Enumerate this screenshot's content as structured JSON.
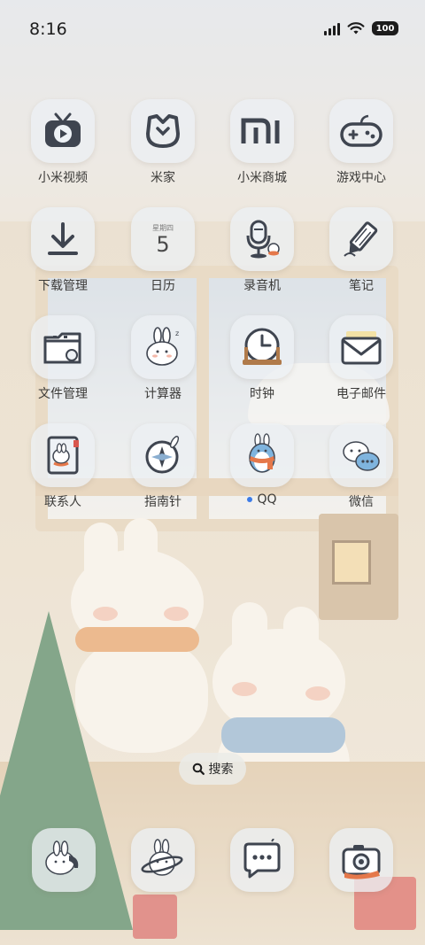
{
  "status_bar": {
    "time": "8:16",
    "battery": "100",
    "icons": [
      "signal-icon",
      "wifi-icon",
      "battery-icon"
    ]
  },
  "apps": [
    {
      "label": "小米视频",
      "icon": "tv-icon"
    },
    {
      "label": "米家",
      "icon": "mijia-icon"
    },
    {
      "label": "小米商城",
      "icon": "mi-logo-icon"
    },
    {
      "label": "游戏中心",
      "icon": "gamepad-icon"
    },
    {
      "label": "下载管理",
      "icon": "download-icon"
    },
    {
      "label": "日历",
      "icon": "calendar-icon",
      "calendar_weekday": "星期四",
      "calendar_day": "5"
    },
    {
      "label": "录音机",
      "icon": "microphone-icon"
    },
    {
      "label": "笔记",
      "icon": "pencil-icon"
    },
    {
      "label": "文件管理",
      "icon": "folder-icon"
    },
    {
      "label": "计算器",
      "icon": "bunny-calculator-icon"
    },
    {
      "label": "时钟",
      "icon": "clock-icon"
    },
    {
      "label": "电子邮件",
      "icon": "envelope-icon"
    },
    {
      "label": "联系人",
      "icon": "contacts-book-icon"
    },
    {
      "label": "指南针",
      "icon": "compass-icon"
    },
    {
      "label": "QQ",
      "icon": "penguin-icon",
      "has_update_dot": true
    },
    {
      "label": "微信",
      "icon": "chat-bubbles-icon"
    }
  ],
  "search": {
    "label": "搜索",
    "icon": "search-icon"
  },
  "dock": [
    {
      "icon": "phone-icon"
    },
    {
      "icon": "planet-bunny-icon"
    },
    {
      "icon": "message-icon"
    },
    {
      "icon": "camera-icon"
    }
  ],
  "colors": {
    "text": "#3b3a38",
    "icon_stroke": "#3f4550",
    "tile_bg": "#eceff3",
    "notification_dot": "#3c7be8"
  }
}
